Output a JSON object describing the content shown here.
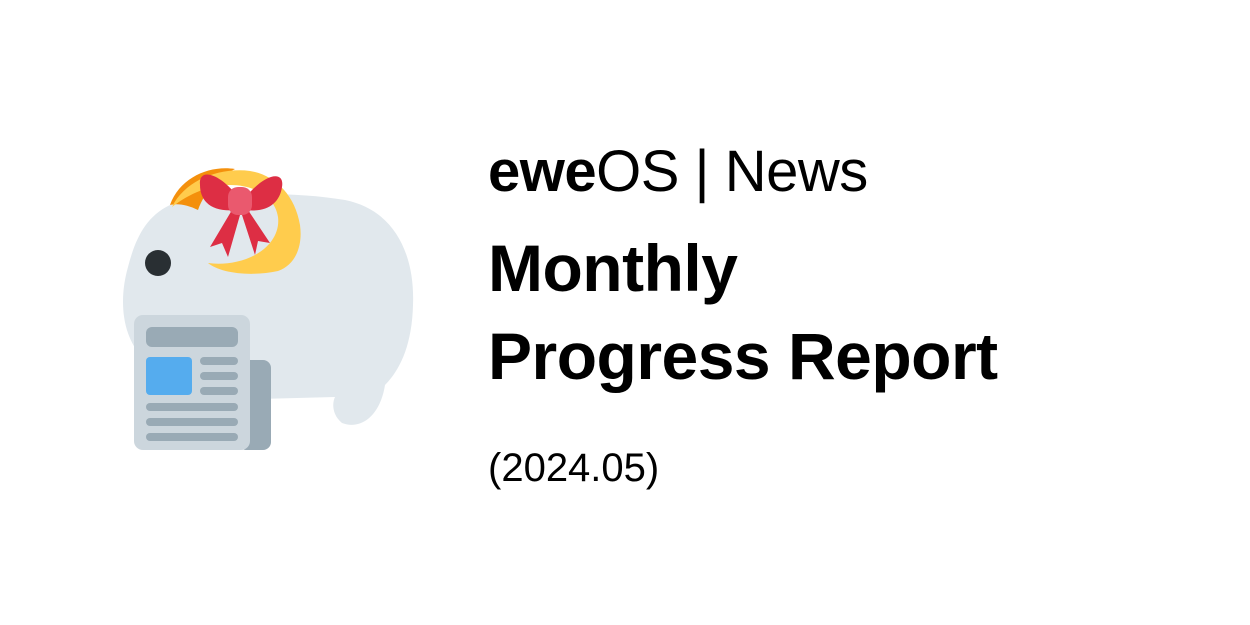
{
  "header": {
    "brand_bold": "ewe",
    "brand_rest": "OS | News"
  },
  "title": {
    "line1": "Monthly",
    "line2": "Progress Report"
  },
  "date": "(2024.05)",
  "logo": {
    "icon": "sheep-with-newspaper-and-bow-icon",
    "colors": {
      "sheep_body": "#e1e8ed",
      "ribbon_gold": "#ffcc4d",
      "ribbon_orange": "#f4900c",
      "bow_red": "#dd2e44",
      "bow_pink": "#ea596e",
      "eye": "#292f33",
      "paper": "#ccd6dd",
      "paper_lines": "#99aab5",
      "paper_photo": "#55acee"
    }
  }
}
